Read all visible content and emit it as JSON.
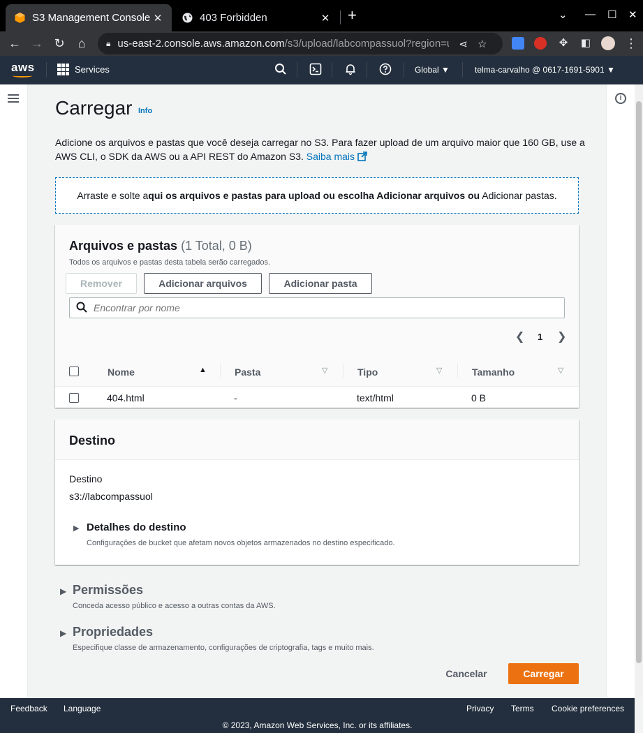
{
  "browser": {
    "tabs": [
      {
        "title": "S3 Management Console",
        "active": true
      },
      {
        "title": "403 Forbidden",
        "active": false
      }
    ],
    "url_host": "us-east-2.console.aws.amazon.com",
    "url_path": "/s3/upload/labcompassuol?region=us-e..."
  },
  "aws_nav": {
    "logo": "aws",
    "services_label": "Services",
    "region": "Global",
    "account": "telma-carvalho @ 0617-1691-5901"
  },
  "page": {
    "title": "Carregar",
    "info_link": "Info",
    "description": "Adicione os arquivos e pastas que você deseja carregar no S3. Para fazer upload de um arquivo maior que 160 GB, use a AWS CLI, o SDK da AWS ou a API REST do Amazon S3.",
    "learn_more": "Saiba mais",
    "dropzone": {
      "part1": "Arraste e solte a",
      "part2": "qui os arquivos e pastas para upload ou escolha Adicionar arquivos ou",
      "part3": " Adicionar pastas."
    }
  },
  "files_panel": {
    "title": "Arquivos e pastas",
    "count": "(1 Total, 0 B)",
    "subtitle": "Todos os arquivos e pastas desta tabela serão carregados.",
    "remove_button": "Remover",
    "add_files_button": "Adicionar arquivos",
    "add_folder_button": "Adicionar pasta",
    "search_placeholder": "Encontrar por nome",
    "page_number": "1",
    "columns": [
      "Nome",
      "Pasta",
      "Tipo",
      "Tamanho"
    ],
    "rows": [
      {
        "name": "404.html",
        "folder": "-",
        "type": "text/html",
        "size": "0 B"
      }
    ]
  },
  "destination": {
    "title": "Destino",
    "label": "Destino",
    "value": "s3://labcompassuol",
    "details_title": "Detalhes do destino",
    "details_sub": "Configurações de bucket que afetam novos objetos armazenados no destino especificado."
  },
  "permissions": {
    "title": "Permissões",
    "sub": "Conceda acesso público e acesso a outras contas da AWS."
  },
  "properties": {
    "title": "Propriedades",
    "sub": "Especifique classe de armazenamento, configurações de criptografia, tags e muito mais."
  },
  "actions": {
    "cancel": "Cancelar",
    "upload": "Carregar"
  },
  "footer": {
    "feedback": "Feedback",
    "language": "Language",
    "privacy": "Privacy",
    "terms": "Terms",
    "cookies": "Cookie preferences",
    "copyright": "© 2023, Amazon Web Services, Inc. or its affiliates."
  },
  "colors": {
    "aws_nav_bg": "#232f3e",
    "link": "#0073bb",
    "primary_button": "#ec7211"
  }
}
